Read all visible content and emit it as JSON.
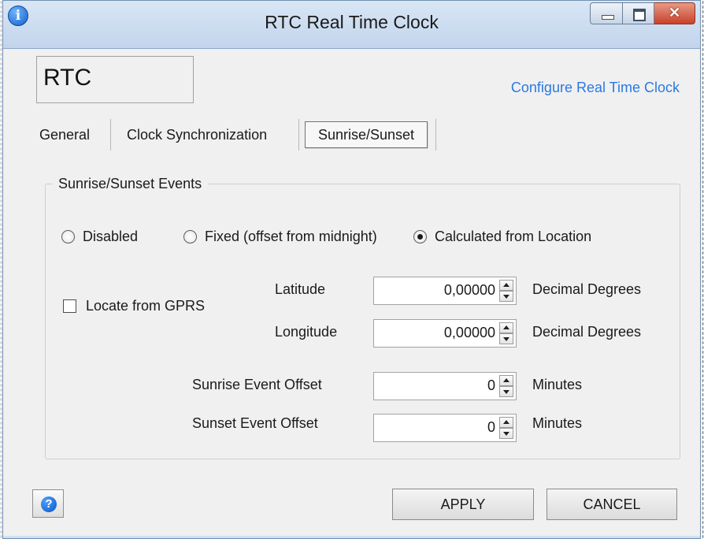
{
  "window": {
    "title": "RTC Real Time Clock",
    "icon": "info-icon",
    "controls": {
      "minimize": "minimize-icon",
      "maximize": "maximize-icon",
      "close": "✕"
    }
  },
  "header": {
    "module_name": "RTC",
    "description_link": "Configure Real Time Clock"
  },
  "tabs": [
    {
      "label": "General",
      "active": false
    },
    {
      "label": "Clock Synchronization",
      "active": false
    },
    {
      "label": "Sunrise/Sunset",
      "active": true
    }
  ],
  "group": {
    "title": "Sunrise/Sunset Events",
    "mode_options": [
      {
        "label": "Disabled",
        "checked": false
      },
      {
        "label": "Fixed (offset from midnight)",
        "checked": false
      },
      {
        "label": "Calculated from Location",
        "checked": true
      }
    ],
    "locate_gprs": {
      "label": "Locate from GPRS",
      "checked": false
    },
    "latitude": {
      "label": "Latitude",
      "value": "0,00000",
      "unit": "Decimal Degrees"
    },
    "longitude": {
      "label": "Longitude",
      "value": "0,00000",
      "unit": "Decimal Degrees"
    },
    "sunrise_offset": {
      "label": "Sunrise Event Offset",
      "value": "0",
      "unit": "Minutes"
    },
    "sunset_offset": {
      "label": "Sunset Event Offset",
      "value": "0",
      "unit": "Minutes"
    }
  },
  "footer": {
    "help_icon": "help-icon",
    "help_glyph": "?",
    "apply_label": "APPLY",
    "cancel_label": "CANCEL"
  },
  "colors": {
    "link": "#2a7ae2",
    "titlebar": "#c2d5ec",
    "close_button": "#c9412a",
    "background": "#f0f0f0"
  }
}
